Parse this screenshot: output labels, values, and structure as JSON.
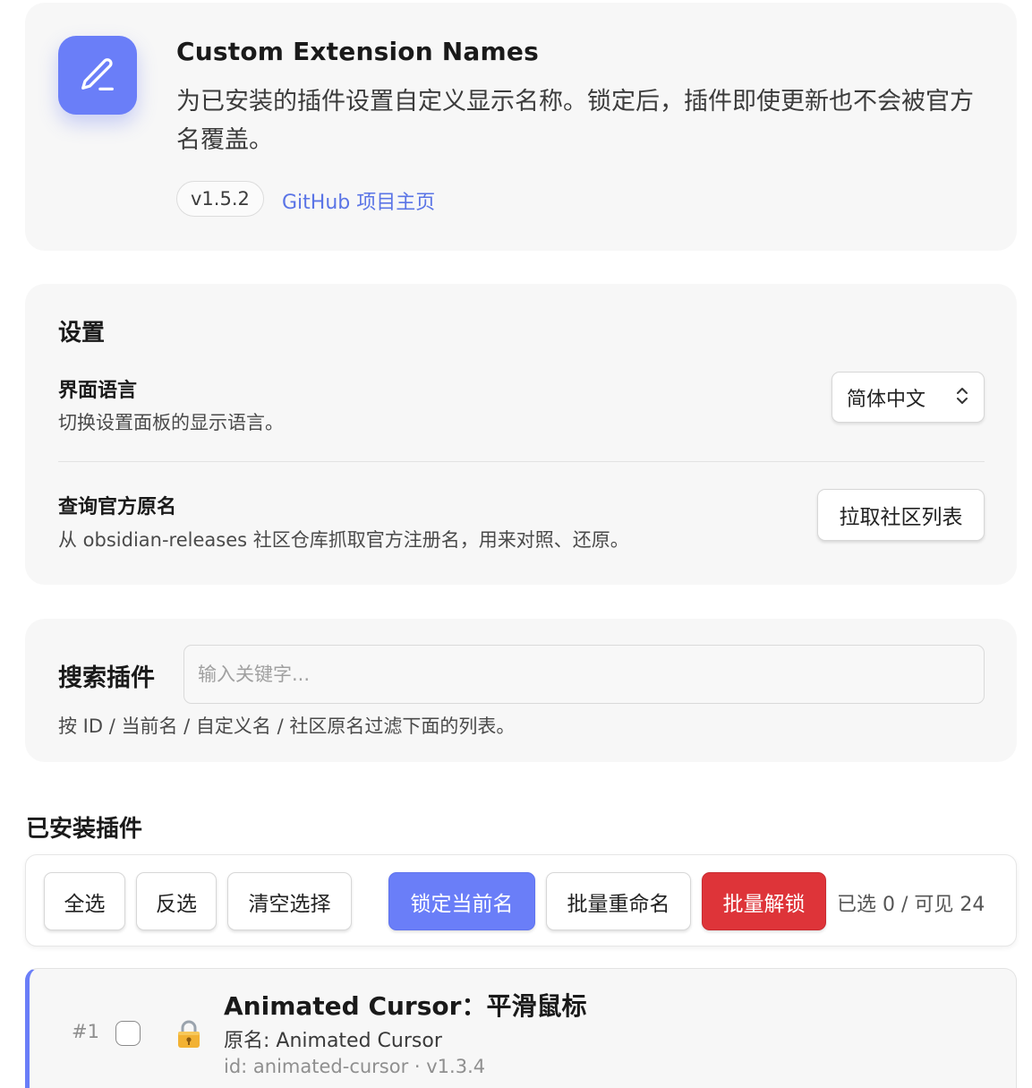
{
  "header": {
    "title": "Custom Extension Names",
    "description": "为已安装的插件设置自定义显示名称。锁定后，插件即使更新也不会被官方名覆盖。",
    "version": "v1.5.2",
    "github_link": "GitHub 项目主页",
    "logo_icon": "pencil-icon",
    "accent_color": "#6a7ef8"
  },
  "settings": {
    "title": "设置",
    "language": {
      "title": "界面语言",
      "description": "切换设置面板的显示语言。",
      "selected": "简体中文"
    },
    "official_names": {
      "title": "查询官方原名",
      "description": "从 obsidian-releases 社区仓库抓取官方注册名，用来对照、还原。",
      "button": "拉取社区列表"
    }
  },
  "search": {
    "label": "搜索插件",
    "placeholder": "输入关键字...",
    "hint": "按 ID / 当前名 / 自定义名 / 社区原名过滤下面的列表。"
  },
  "installed": {
    "title": "已安装插件",
    "toolbar": {
      "select_all": "全选",
      "invert": "反选",
      "clear": "清空选择",
      "lock": "锁定当前名",
      "batch_rename": "批量重命名",
      "batch_unlock": "批量解锁",
      "count": "已选 0 / 可见 24",
      "danger_color": "#de3439"
    },
    "plugins": [
      {
        "index": "#1",
        "checked": false,
        "locked": true,
        "lock_icon": "lock-icon",
        "name": "Animated Cursor：平滑鼠标",
        "original": "原名: Animated Cursor",
        "meta": "id: animated-cursor · v1.3.4"
      }
    ]
  }
}
